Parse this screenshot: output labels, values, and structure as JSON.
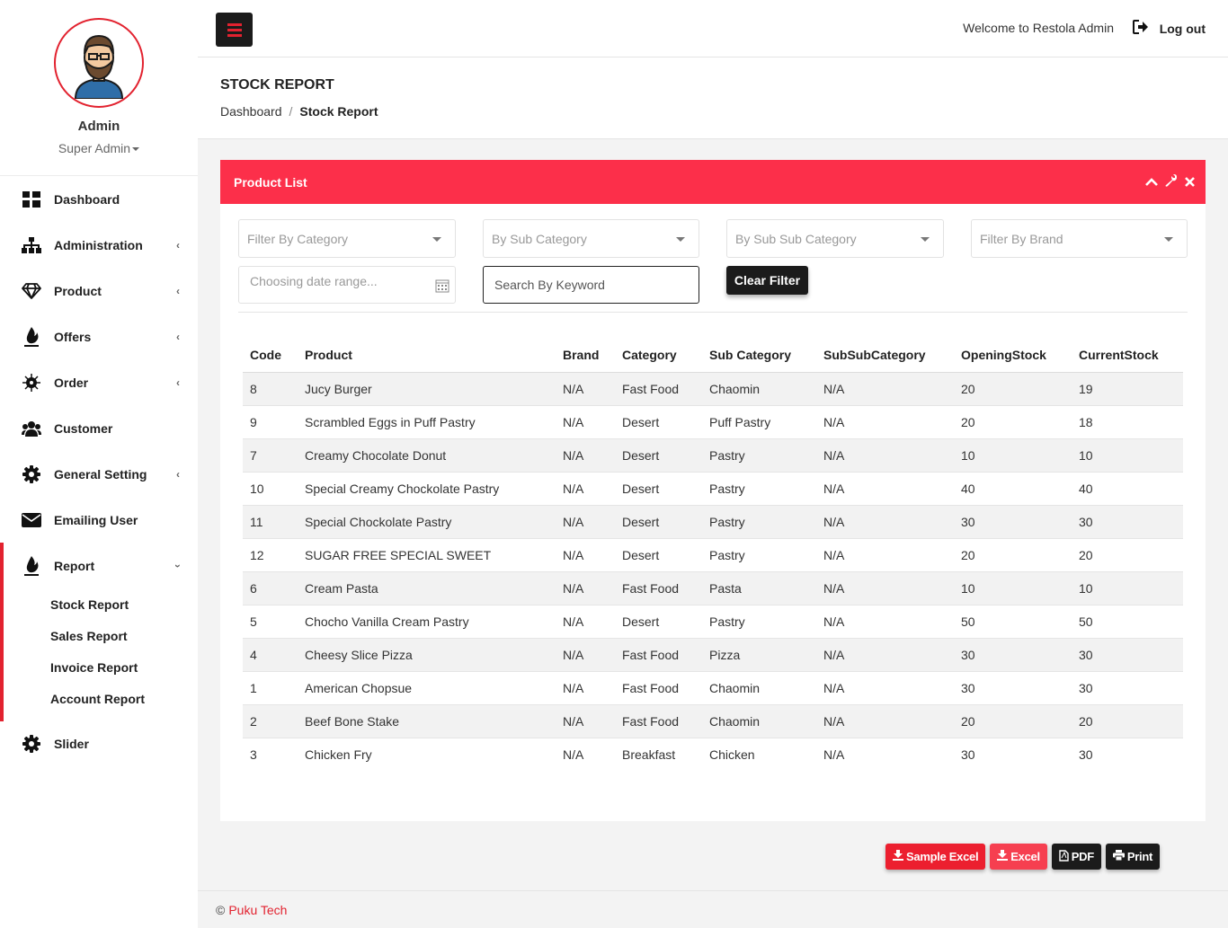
{
  "profile": {
    "name": "Admin",
    "role": "Super Admin"
  },
  "sidebar": {
    "items": [
      {
        "label": "Dashboard",
        "icon": "dashboard-icon",
        "has_children": false
      },
      {
        "label": "Administration",
        "icon": "sitemap-icon",
        "has_children": true
      },
      {
        "label": "Product",
        "icon": "diamond-icon",
        "has_children": true
      },
      {
        "label": "Offers",
        "icon": "fire-icon",
        "has_children": true
      },
      {
        "label": "Order",
        "icon": "virus-icon",
        "has_children": true
      },
      {
        "label": "Customer",
        "icon": "users-icon",
        "has_children": false
      },
      {
        "label": "General Setting",
        "icon": "gear-icon",
        "has_children": true
      },
      {
        "label": "Emailing User",
        "icon": "envelope-icon",
        "has_children": false
      }
    ],
    "report": {
      "label": "Report",
      "icon": "fire-icon",
      "subitems": [
        "Stock Report",
        "Sales Report",
        "Invoice Report",
        "Account Report"
      ]
    },
    "slider": {
      "label": "Slider",
      "icon": "gear-icon"
    }
  },
  "topbar": {
    "welcome": "Welcome to Restola Admin",
    "logout": "Log out"
  },
  "header": {
    "title": "STOCK REPORT",
    "breadcrumb_home": "Dashboard",
    "breadcrumb_sep": "/",
    "breadcrumb_current": "Stock Report"
  },
  "panel": {
    "title": "Product List"
  },
  "filters": {
    "category": "Filter By Category",
    "sub_category": "By Sub Category",
    "sub_sub_category": "By Sub Sub Category",
    "brand": "Filter By Brand",
    "date_range": "Choosing date range...",
    "search": "Search By Keyword",
    "clear": "Clear Filter"
  },
  "table": {
    "columns": [
      "Code",
      "Product",
      "Brand",
      "Category",
      "Sub Category",
      "SubSubCategory",
      "OpeningStock",
      "CurrentStock"
    ],
    "rows": [
      [
        "8",
        "Jucy Burger",
        "N/A",
        "Fast Food",
        "Chaomin",
        "N/A",
        "20",
        "19"
      ],
      [
        "9",
        "Scrambled Eggs in Puff Pastry",
        "N/A",
        "Desert",
        "Puff Pastry",
        "N/A",
        "20",
        "18"
      ],
      [
        "7",
        "Creamy Chocolate Donut",
        "N/A",
        "Desert",
        "Pastry",
        "N/A",
        "10",
        "10"
      ],
      [
        "10",
        "Special Creamy Chockolate Pastry",
        "N/A",
        "Desert",
        "Pastry",
        "N/A",
        "40",
        "40"
      ],
      [
        "11",
        "Special Chockolate Pastry",
        "N/A",
        "Desert",
        "Pastry",
        "N/A",
        "30",
        "30"
      ],
      [
        "12",
        "SUGAR FREE SPECIAL SWEET",
        "N/A",
        "Desert",
        "Pastry",
        "N/A",
        "20",
        "20"
      ],
      [
        "6",
        "Cream Pasta",
        "N/A",
        "Fast Food",
        "Pasta",
        "N/A",
        "10",
        "10"
      ],
      [
        "5",
        "Chocho Vanilla Cream Pastry",
        "N/A",
        "Desert",
        "Pastry",
        "N/A",
        "50",
        "50"
      ],
      [
        "4",
        "Cheesy Slice Pizza",
        "N/A",
        "Fast Food",
        "Pizza",
        "N/A",
        "30",
        "30"
      ],
      [
        "1",
        "American Chopsue",
        "N/A",
        "Fast Food",
        "Chaomin",
        "N/A",
        "30",
        "30"
      ],
      [
        "2",
        "Beef Bone Stake",
        "N/A",
        "Fast Food",
        "Chaomin",
        "N/A",
        "20",
        "20"
      ],
      [
        "3",
        "Chicken Fry",
        "N/A",
        "Breakfast",
        "Chicken",
        "N/A",
        "30",
        "30"
      ]
    ]
  },
  "buttons": {
    "sample_excel": "Sample Excel",
    "excel": "Excel",
    "pdf": "PDF",
    "print": "Print"
  },
  "footer": {
    "copyright": "©",
    "brand": "Puku Tech"
  },
  "colors": {
    "accent": "#fc2f4a",
    "brand_red": "#e2222f",
    "dark": "#1b1b1b"
  }
}
